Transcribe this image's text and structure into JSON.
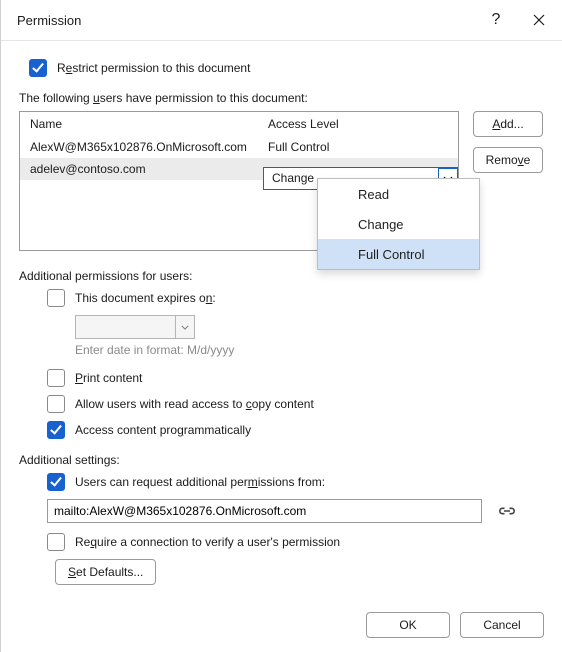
{
  "title": {
    "text": "Permission"
  },
  "restrict": {
    "before": "R",
    "hotkey": "e",
    "after": "strict permission to this document"
  },
  "users": {
    "label_before": "The following ",
    "label_hotkey": "u",
    "label_after": "sers have permission to this document:",
    "columns": [
      "Name",
      "Access Level"
    ],
    "rows": [
      {
        "name": "AlexW@M365x102876.OnMicrosoft.com",
        "access": "Full Control"
      },
      {
        "name": "adelev@contoso.com",
        "access": "Change"
      }
    ]
  },
  "dropdown": [
    "Read",
    "Change",
    "Full Control"
  ],
  "buttons": {
    "add_hotkey": "A",
    "add_after": "dd...",
    "remove_before": "Remo",
    "remove_hotkey": "v",
    "remove_after": "e",
    "defaults_hotkey": "S",
    "defaults_after": "et Defaults...",
    "ok": "OK",
    "cancel": "Cancel"
  },
  "additional": {
    "label": "Additional permissions for users:",
    "expires": {
      "before": "This document expires o",
      "hotkey": "n",
      "after": ":"
    },
    "date_hint": "Enter date in format: M/d/yyyy",
    "print": {
      "hotkey": "P",
      "after": "rint content"
    },
    "copy": {
      "before": "Allow users with read access to ",
      "hotkey": "c",
      "after": "opy content"
    },
    "programmatic": {
      "before": "Access content pro",
      "hotkey": "g",
      "after": "rammatically"
    }
  },
  "settings": {
    "label": "Additional settings:",
    "request": {
      "before": "Users can request additional per",
      "hotkey": "m",
      "after": "issions from:"
    },
    "request_url": "mailto:AlexW@M365x102876.OnMicrosoft.com",
    "verify": {
      "before": "Re",
      "hotkey": "q",
      "after": "uire a connection to verify a user's permission"
    }
  }
}
